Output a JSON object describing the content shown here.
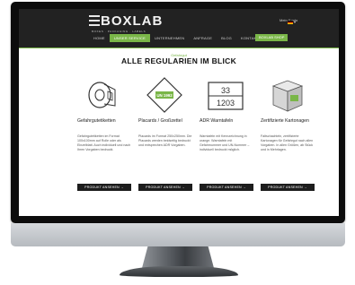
{
  "header": {
    "logo_text": "BOXLAB",
    "logo_tagline": "BOXES · PACKAGING · LABELS",
    "top_link": "Mein Konto",
    "language": "DE"
  },
  "nav": {
    "items": [
      {
        "label": "HOME",
        "active": false
      },
      {
        "label": "UNSER SERVICE",
        "active": true
      },
      {
        "label": "UNTERNEHMEN",
        "active": false
      },
      {
        "label": "ANFRAGE",
        "active": false
      },
      {
        "label": "BLOG",
        "active": false
      },
      {
        "label": "KONTAKT",
        "active": false
      }
    ],
    "cta_label": "BOXLAB SHOP"
  },
  "main": {
    "eyebrow": "Gefahrgut",
    "title": "ALLE REGULARIEN IM BLICK"
  },
  "cards": [
    {
      "icon": "tape-roll-icon",
      "title": "Gefahrgutetiketten",
      "description": "Gefahrgutetiketten im Format 100x100mm auf Rolle oder als Einzelblatt. Auch individuell und nach Ihren Vorgaben bedruckt.",
      "button": "PRODUKT ANSEHEN"
    },
    {
      "icon": "un-diamond-icon",
      "title": "Placards / Großzettel",
      "description": "Placards im Format 250x250mm. Die Placards werden beidseitig bedruckt und entsprechen ADR Vorgaben.",
      "button": "PRODUKT ANSEHEN"
    },
    {
      "icon": "adr-plate-icon",
      "title": "ADR Warntafeln",
      "description": "Warntafeln mit Kennzeichnung in orange. Warntafeln mit Gefahrnummer und UN-Nummer – individuell bedruckt möglich.",
      "button": "PRODUKT ANSEHEN"
    },
    {
      "icon": "box-icon",
      "title": "Zertifizierte Kartonagen",
      "description": "Faltschachteln, zertifizierte Kartonagen für Gefahrgut nach allen Vorgaben. In allen Größen, ab Stück und in Mehrlagen.",
      "button": "PRODUKT ANSEHEN"
    }
  ],
  "adr_plate": {
    "hazard_number": "33",
    "un_number": "1203"
  },
  "un_diamond_text": "UN 1992",
  "colors": {
    "accent": "#7ab648",
    "header_bg": "#222222",
    "button_bg": "#1d1d1d"
  }
}
